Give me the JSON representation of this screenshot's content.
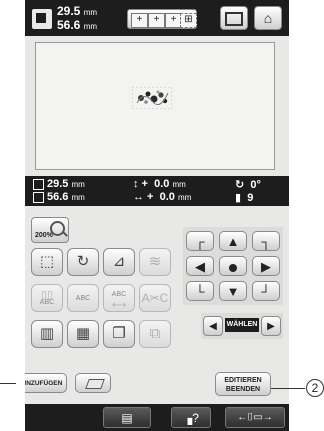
{
  "header": {
    "height_value": "29.5",
    "height_unit": "mm",
    "width_value": "56.6",
    "width_unit": "mm",
    "thread_buttons": [
      "+",
      "+",
      "+"
    ],
    "resize_icon": "resize-icon",
    "home_icon": "home-icon"
  },
  "info": {
    "height_value": "29.5",
    "height_unit": "mm",
    "width_value": "56.6",
    "width_unit": "mm",
    "offset_y_prefix": "↕ +",
    "offset_y_value": "0.0",
    "offset_y_unit": "mm",
    "offset_x_prefix": "↔ +",
    "offset_x_value": "0.0",
    "offset_x_unit": "mm",
    "rotation_value": "0°",
    "color_count": "9"
  },
  "zoom": {
    "label": "200%"
  },
  "nav": {
    "select_label": "WÄHLEN"
  },
  "edit_buttons": {
    "mirror_abc": "ABC",
    "spacing_abc": "ABC",
    "array_abc": "ABC"
  },
  "actions": {
    "add_label": "HINZUFÜGEN",
    "finish_label_1": "EDITIEREN",
    "finish_label_2": "BEENDEN"
  },
  "callout": {
    "number": "2"
  },
  "colors": {
    "screen_bg": "#e8e8e6",
    "bar_bg": "#1d1d1d",
    "button_face": "#ffffff"
  }
}
